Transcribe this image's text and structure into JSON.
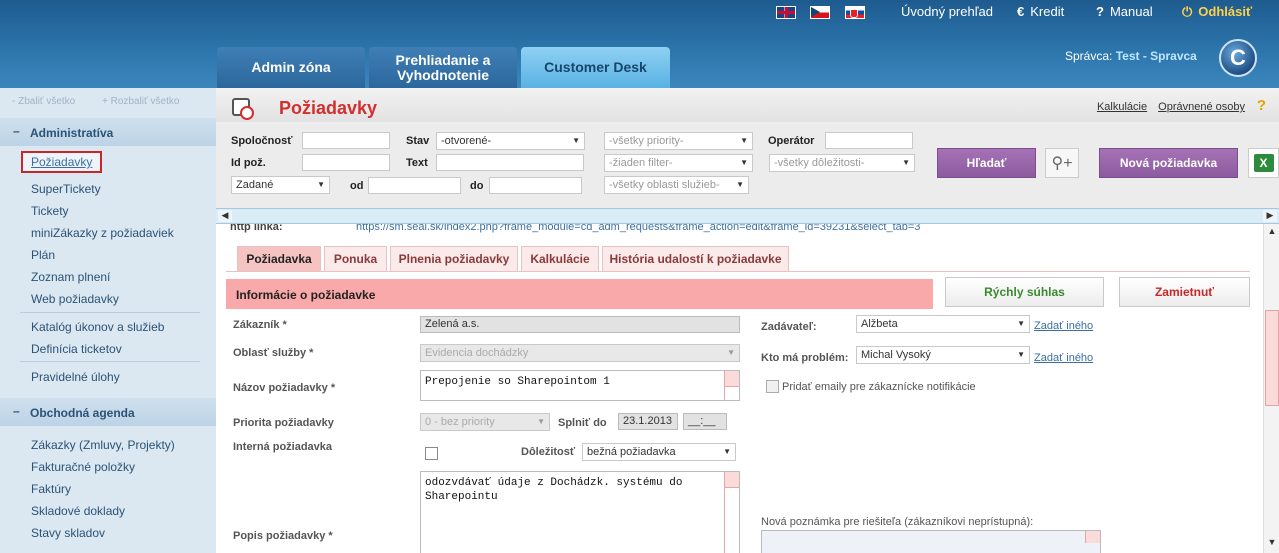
{
  "header": {
    "flags": [
      "uk-flag",
      "cz-flag",
      "sk-flag"
    ],
    "links": {
      "overview": "Úvodný prehľad",
      "credit_icon": "€",
      "credit": "Kredit",
      "manual_icon": "?",
      "manual": "Manual",
      "logout_icon": "⏻",
      "logout": "Odhlásiť"
    },
    "tabs": {
      "admin": "Admin zóna",
      "prehl_line1": "Prehliadanie a",
      "prehl_line2": "Vyhodnotenie",
      "customer": "Customer Desk"
    },
    "admin_prefix": "Správca:",
    "admin_name": "Test - Spravca",
    "logo_letter": "C"
  },
  "sidebar": {
    "collapse_all": "Zbaliť všetko",
    "expand_all": "Rozbaliť všetko",
    "sections": {
      "administrativa": "Administratíva",
      "obchodna": "Obchodná agenda"
    },
    "items": {
      "poziadavky": "Požiadavky",
      "supertickety": "SuperTickety",
      "tickety": "Tickety",
      "minizakazky": "miniZákazky z požiadaviek",
      "plan": "Plán",
      "zoznam_plneni": "Zoznam plnení",
      "web_poziadavky": "Web požiadavky",
      "katalog": "Katalóg úkonov a služieb",
      "definicia": "Definícia ticketov",
      "pravidelne": "Pravidelné úlohy",
      "zakazky": "Zákazky (Zmluvy, Projekty)",
      "fakturacne": "Fakturačné položky",
      "faktury": "Faktúry",
      "skladove": "Skladové doklady",
      "stavy": "Stavy skladov"
    }
  },
  "main": {
    "title": "Požiadavky",
    "top_links": {
      "kalkulacie": "Kalkulácie",
      "opravnene": "Oprávnené osoby"
    },
    "help": "?",
    "filter": {
      "spolocnost_label": "Spoločnosť",
      "stav_label": "Stav",
      "stav_value": "-otvorené-",
      "priority_value": "-všetky priority-",
      "operator_label": "Operátor",
      "idpoz_label": "Id pož.",
      "text_label": "Text",
      "filter_value": "-žiaden filter-",
      "dolezitost_value": "-všetky dôležitosti-",
      "zadane_value": "Zadané",
      "od_label": "od",
      "do_label": "do",
      "oblasti_value": "-všetky oblasti služieb-",
      "search_button": "Hľadať",
      "new_button": "Nová požiadavka",
      "excel_icon": "X"
    },
    "detail": {
      "http_label": "http linka:",
      "http_url": "https://sm.seal.sk/index2.php?frame_module=cd_adm_requests&frame_action=edit&frame_id=39231&select_tab=3",
      "tabs": [
        "Požiadavka",
        "Ponuka",
        "Plnenia požiadavky",
        "Kalkulácie",
        "História udalostí k požiadavke"
      ],
      "section_title": "Informácie o požiadavke",
      "quick_approve": "Rýchly súhlas",
      "reject": "Zamietnuť",
      "zakaznik_label": "Zákazník *",
      "zakaznik_value": "Zelená a.s.",
      "oblast_label": "Oblasť služby *",
      "oblast_value": "Evidencia dochádzky",
      "nazov_label": "Názov požiadavky *",
      "nazov_value": "Prepojenie so Sharepointom 1",
      "priorita_label": "Priorita požiadavky",
      "priorita_value": "0 - bez priority",
      "splnit_label": "Splniť do",
      "splnit_date": "23.1.2013",
      "splnit_time": "__:__",
      "interna_label": "Interná požiadavka",
      "dolezitost_label": "Dôležitosť",
      "dolezitost_value": "bežná požiadavka",
      "popis_label": "Popis požiadavky *",
      "popis_value": "odozvdávať údaje z Dochádzk. systému do Sharepointu",
      "zadavatel_label": "Zadávateľ:",
      "zadavatel_value": "Alžbeta",
      "zadat_ineho": "Zadať iného",
      "problem_label": "Kto má problém:",
      "problem_value": "Michal Vysoký",
      "pridat_emaily": "Pridať emaily pre zákaznícke notifikácie",
      "nova_poznamka": "Nová poznámka pre riešiteľa (zákazníkovi neprístupná):"
    }
  }
}
